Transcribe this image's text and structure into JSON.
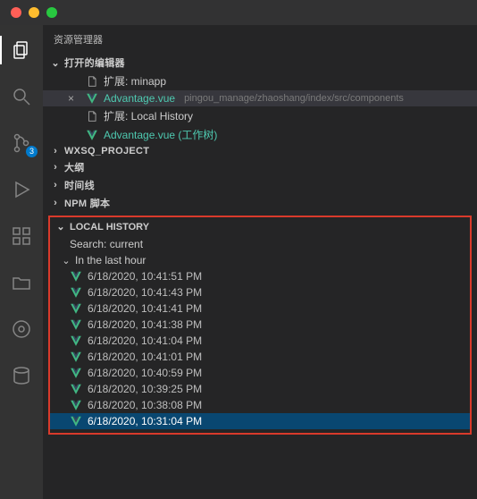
{
  "titlebar": {},
  "activitybar": {
    "scm_badge": "3"
  },
  "sidebar": {
    "title": "资源管理器",
    "open_editors_label": "打开的编辑器",
    "editors": [
      {
        "close": "",
        "name": "扩展: minapp",
        "path": "",
        "vue": false,
        "active": false
      },
      {
        "close": "×",
        "name": "Advantage.vue",
        "path": "pingou_manage/zhaoshang/index/src/components",
        "vue": true,
        "active": true
      },
      {
        "close": "",
        "name": "扩展: Local History",
        "path": "",
        "vue": false,
        "active": false
      },
      {
        "close": "",
        "name": "Advantage.vue (工作树)",
        "path": "",
        "vue": true,
        "active": false
      }
    ],
    "sections": [
      {
        "label": "WXSQ_PROJECT",
        "chev": "›"
      },
      {
        "label": "大纲",
        "chev": "›"
      },
      {
        "label": "时间线",
        "chev": "›"
      },
      {
        "label": "NPM 脚本",
        "chev": "›"
      }
    ],
    "local_history": {
      "header": "LOCAL HISTORY",
      "search": "Search: current",
      "group_label": "In the last hour",
      "items": [
        "6/18/2020, 10:41:51 PM",
        "6/18/2020, 10:41:43 PM",
        "6/18/2020, 10:41:41 PM",
        "6/18/2020, 10:41:38 PM",
        "6/18/2020, 10:41:04 PM",
        "6/18/2020, 10:41:01 PM",
        "6/18/2020, 10:40:59 PM",
        "6/18/2020, 10:39:25 PM",
        "6/18/2020, 10:38:08 PM",
        "6/18/2020, 10:31:04 PM"
      ],
      "selected_index": 9
    }
  }
}
